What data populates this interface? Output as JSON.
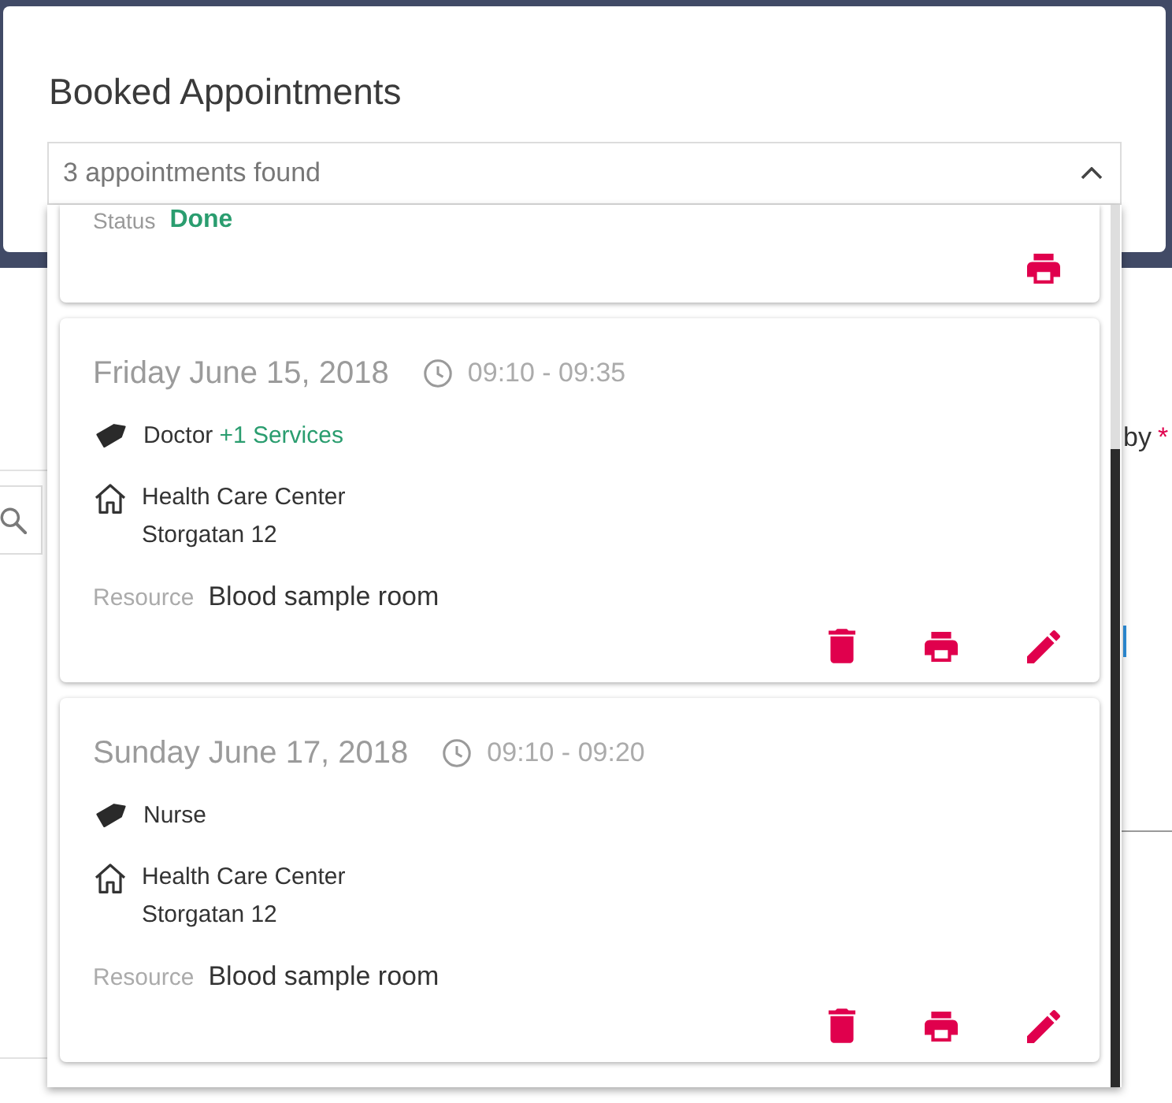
{
  "header": {
    "title": "Booked Appointments"
  },
  "dropdown": {
    "value": "3 appointments found",
    "expanded": true
  },
  "appointments": [
    {
      "kind": "completed",
      "status_label": "Status",
      "status": "Done"
    },
    {
      "kind": "upcoming",
      "date": "Friday June 15, 2018",
      "time": "09:10 - 09:35",
      "service": "Doctor",
      "extra_services": "+1 Services",
      "location": "Health Care Center",
      "address": "Storgatan 12",
      "resource_label": "Resource",
      "resource": "Blood sample room"
    },
    {
      "kind": "upcoming",
      "date": "Sunday June 17, 2018",
      "time": "09:10 - 09:20",
      "service": "Nurse",
      "location": "Health Care Center",
      "address": "Storgatan 12",
      "resource_label": "Resource",
      "resource": "Blood sample room"
    }
  ],
  "background": {
    "field_label": "by",
    "required_mark": "*"
  }
}
